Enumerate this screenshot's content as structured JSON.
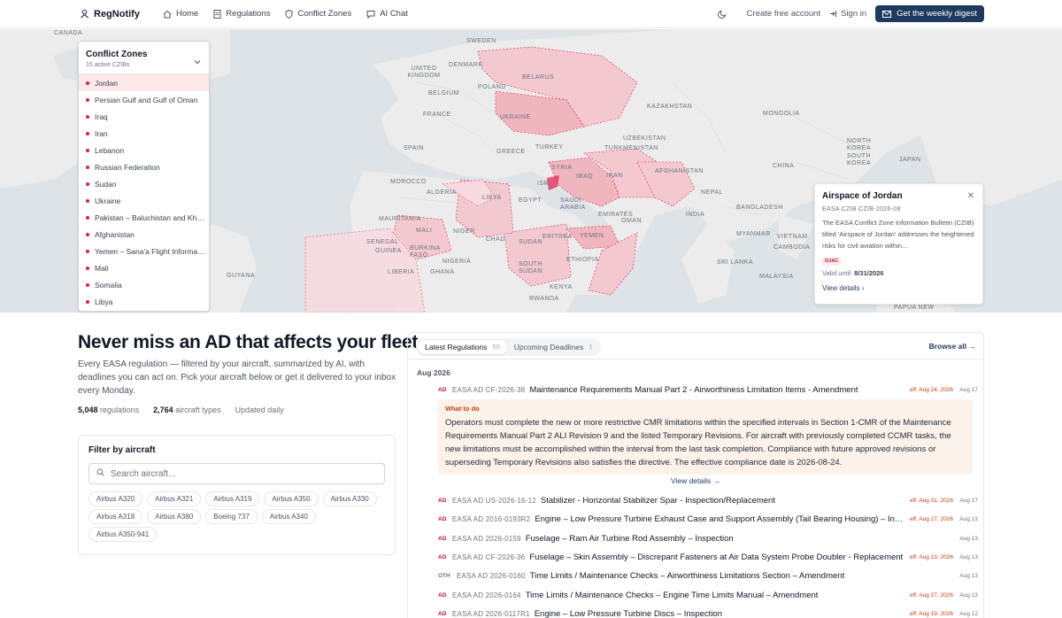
{
  "nav": {
    "brand": "RegNotify",
    "links": [
      "Home",
      "Regulations",
      "Conflict Zones",
      "AI Chat"
    ],
    "create_account": "Create free account",
    "sign_in": "Sign in",
    "cta": "Get the weekly digest"
  },
  "map": {
    "labels": [
      "CANADA",
      "SWEDEN",
      "UNITED KINGDOM",
      "DENMARK",
      "BELARUS",
      "POLAND",
      "BELGIUM",
      "FRANCE",
      "UKRAINE",
      "KAZAKHSTAN",
      "MONGOLIA",
      "UZBEKISTAN",
      "SPAIN",
      "GREECE",
      "TURKEY",
      "TURKMENISTAN",
      "NORTH KOREA",
      "SOUTH KOREA",
      "JAPAN",
      "CHINA",
      "SYRIA",
      "IRAQ",
      "IRAN",
      "AFGHANISTAN",
      "MOROCCO",
      "ALGERIA",
      "LIBYA",
      "EGYPT",
      "ISR",
      "SAUDI ARABIA",
      "NEPAL",
      "BANGLADESH",
      "INDIA",
      "MAURITANIA",
      "MALI",
      "NIGER",
      "CHAD",
      "SUDAN",
      "ERITREA",
      "YEMEN",
      "OMAN",
      "EMIRATES",
      "MYANMAR",
      "VIETNAM",
      "CAMBODIA",
      "SENEGAL",
      "GUINEA",
      "BURKINA FASO",
      "NIGERIA",
      "SOUTH SUDAN",
      "ETHIOPIA",
      "SRI LANKA",
      "GUYANA",
      "LIBERIA",
      "GHANA",
      "KENYA",
      "MALAYSIA",
      "RWANDA",
      "PAPUA NEW"
    ]
  },
  "conflict_zones": {
    "title": "Conflict Zones",
    "subtitle": "15 active CZIBs",
    "items": [
      "Jordan",
      "Persian Gulf and Gulf of Oman",
      "Iraq",
      "Iran",
      "Lebanon",
      "Russian Federation",
      "Sudan",
      "Ukraine",
      "Pakistan – Baluchistan and Kh…",
      "Afghanistan",
      "Yemen – Sana'a Flight Informa…",
      "Mali",
      "Somalia",
      "Libya"
    ]
  },
  "info_card": {
    "title": "Airspace of Jordan",
    "id": "EASA CZIB CZIB-2026-08",
    "description": "The EASA Conflict Zone Information Bulletin (CZIB) titled 'Airspace of Jordan' addresses the heightened risks for civil aviation within...",
    "badge": "OJAC",
    "valid_label": "Valid until:",
    "valid_date": "8/31/2026",
    "link": "View details"
  },
  "hero": {
    "title": "Never miss an AD that affects your fleet.",
    "description": "Every EASA regulation — filtered by your aircraft, summarized by AI, with deadlines you can act on. Pick your aircraft below or get it delivered to your inbox every Monday.",
    "stats": [
      {
        "value": "5,048",
        "label": "regulations"
      },
      {
        "value": "2,764",
        "label": "aircraft types"
      },
      {
        "value": "",
        "label": "Updated daily"
      }
    ]
  },
  "filter": {
    "title": "Filter by aircraft",
    "placeholder": "Search aircraft...",
    "chips": [
      "Airbus A320",
      "Airbus A321",
      "Airbus A319",
      "Airbus A350",
      "Airbus A330",
      "Airbus A318",
      "Airbus A380",
      "Boeing 737",
      "Airbus A340",
      "Airbus A350-941"
    ]
  },
  "regulations": {
    "tabs": [
      {
        "label": "Latest Regulations",
        "count": "50"
      },
      {
        "label": "Upcoming Deadlines",
        "count": "1"
      }
    ],
    "browse": "Browse all →",
    "month": "Aug 2026",
    "what_to_do_label": "What to do",
    "what_to_do": "Operators must complete the new or more restrictive CMR limitations within the specified intervals in Section 1-CMR of the Maintenance Requirements Manual Part 2 ALI Revision 9 and the listed Temporary Revisions. For aircraft with previously completed CCMR tasks, the new limitations must be accomplished within the interval from the last task completion. Compliance with future approved revisions or superseding Temporary Revisions also satisfies the directive. The effective compliance date is 2026-08-24.",
    "view_details": "View details →",
    "rows": [
      {
        "kind": "AD",
        "id": "EASA AD CF-2026-38",
        "title": "Maintenance Requirements Manual Part 2 - Airworthiness Limitation Items - Amendment",
        "eff": "eff. Aug 24, 2026",
        "date": "Aug 17"
      },
      {
        "kind": "AD",
        "id": "EASA AD US-2026-16-12",
        "title": "Stabilizer - Horizontal Stabilizer Spar - Inspection/Replacement",
        "eff": "eff. Aug 31, 2026",
        "date": "Aug 17"
      },
      {
        "kind": "AD",
        "id": "EASA AD 2016-0193R2",
        "title": "Engine – Low Pressure Turbine Exhaust Case and Support Assembly (Tail Bearing Housing) – Inspection",
        "eff": "eff. Aug 27, 2026",
        "date": "Aug 13"
      },
      {
        "kind": "AD",
        "id": "EASA AD 2026-0159",
        "title": "Fuselage – Ram Air Turbine Rod Assembly – Inspection",
        "eff": "",
        "date": "Aug 13"
      },
      {
        "kind": "AD",
        "id": "EASA AD CF-2026-36",
        "title": "Fuselage – Skin Assembly – Discrepant Fasteners at Air Data System Probe Doubler - Replacement",
        "eff": "eff. Aug 13, 2026",
        "date": "Aug 13"
      },
      {
        "kind": "OTH",
        "id": "EASA AD 2026-0160",
        "title": "Time Limits / Maintenance Checks – Airworthiness Limitations Section – Amendment",
        "eff": "",
        "date": "Aug 13"
      },
      {
        "kind": "AD",
        "id": "EASA AD 2026-0164",
        "title": "Time Limits / Maintenance Checks – Engine Time Limits Manual – Amendment",
        "eff": "eff. Aug 27, 2026",
        "date": "Aug 13"
      },
      {
        "kind": "AD",
        "id": "EASA AD 2026-0117R1",
        "title": "Engine – Low Pressure Turbine Discs – Inspection",
        "eff": "eff. Aug 19, 2026",
        "date": "Aug 12"
      }
    ]
  },
  "colors": {
    "accent": "#1e3a5f",
    "conflict": "#e11d48",
    "conflict_bg": "#fde8ea",
    "warning": "#c2410c"
  }
}
